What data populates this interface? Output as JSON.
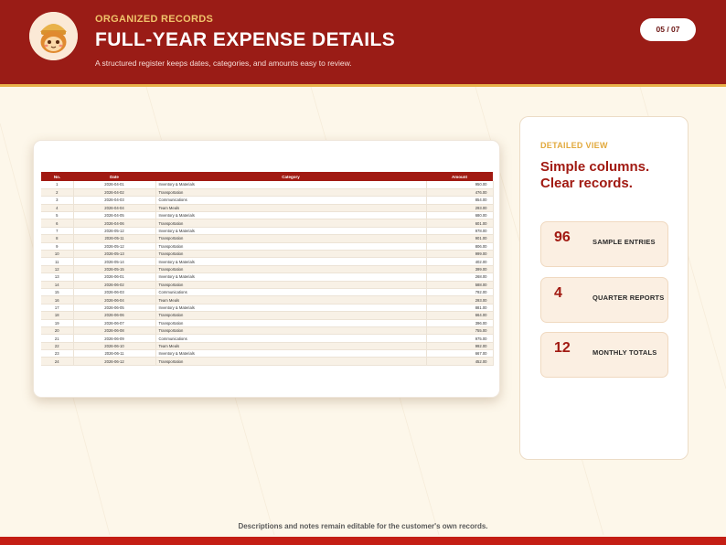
{
  "header": {
    "eyebrow": "ORGANIZED RECORDS",
    "title": "FULL-YEAR EXPENSE DETAILS",
    "subtitle": "A structured register keeps dates, categories, and amounts easy to review.",
    "page_indicator": "05 / 07"
  },
  "table": {
    "columns": [
      "No.",
      "Date",
      "Category",
      "Amount"
    ],
    "rows": [
      [
        "1",
        "2026-04-01",
        "Inventory & Materials",
        "950.00"
      ],
      [
        "2",
        "2026-04-02",
        "Transportation",
        "476.00"
      ],
      [
        "3",
        "2026-04-03",
        "Communications",
        "854.00"
      ],
      [
        "4",
        "2026-04-04",
        "Team Meals",
        "293.00"
      ],
      [
        "5",
        "2026-04-05",
        "Inventory & Materials",
        "680.00"
      ],
      [
        "6",
        "2026-04-06",
        "Transportation",
        "601.00"
      ],
      [
        "7",
        "2026-05-12",
        "Inventory & Materials",
        "978.00"
      ],
      [
        "8",
        "2026-05-11",
        "Transportation",
        "901.00"
      ],
      [
        "9",
        "2026-05-12",
        "Transportation",
        "806.00"
      ],
      [
        "10",
        "2026-05-13",
        "Transportation",
        "999.00"
      ],
      [
        "11",
        "2026-05-14",
        "Inventory & Materials",
        "402.00"
      ],
      [
        "12",
        "2026-05-15",
        "Transportation",
        "399.00"
      ],
      [
        "13",
        "2026-06-01",
        "Inventory & Materials",
        "268.00"
      ],
      [
        "14",
        "2026-06-02",
        "Transportation",
        "588.00"
      ],
      [
        "15",
        "2026-06-03",
        "Communications",
        "792.00"
      ],
      [
        "16",
        "2026-06-04",
        "Team Meals",
        "293.00"
      ],
      [
        "17",
        "2026-06-05",
        "Inventory & Materials",
        "881.00"
      ],
      [
        "18",
        "2026-06-06",
        "Transportation",
        "664.00"
      ],
      [
        "19",
        "2026-06-07",
        "Transportation",
        "396.00"
      ],
      [
        "20",
        "2026-06-08",
        "Transportation",
        "755.00"
      ],
      [
        "21",
        "2026-06-09",
        "Communications",
        "975.00"
      ],
      [
        "22",
        "2026-06-10",
        "Team Meals",
        "992.00"
      ],
      [
        "23",
        "2026-06-11",
        "Inventory & Materials",
        "667.00"
      ],
      [
        "24",
        "2026-06-12",
        "Transportation",
        "452.00"
      ]
    ]
  },
  "side": {
    "eyebrow": "DETAILED VIEW",
    "headline_line1": "Simple columns.",
    "headline_line2": "Clear records.",
    "stats": [
      {
        "value": "96",
        "label": "SAMPLE ENTRIES"
      },
      {
        "value": "4",
        "label": "QUARTER REPORTS"
      },
      {
        "value": "12",
        "label": "MONTHLY TOTALS"
      }
    ]
  },
  "footer": {
    "note": "Descriptions and notes remain editable for the customer's own records."
  },
  "colors": {
    "brand_red": "#9a1c16",
    "accent_gold": "#e9b24a",
    "background": "#fdf7ea"
  },
  "icons": {
    "logo": "mascot-logo-icon"
  }
}
